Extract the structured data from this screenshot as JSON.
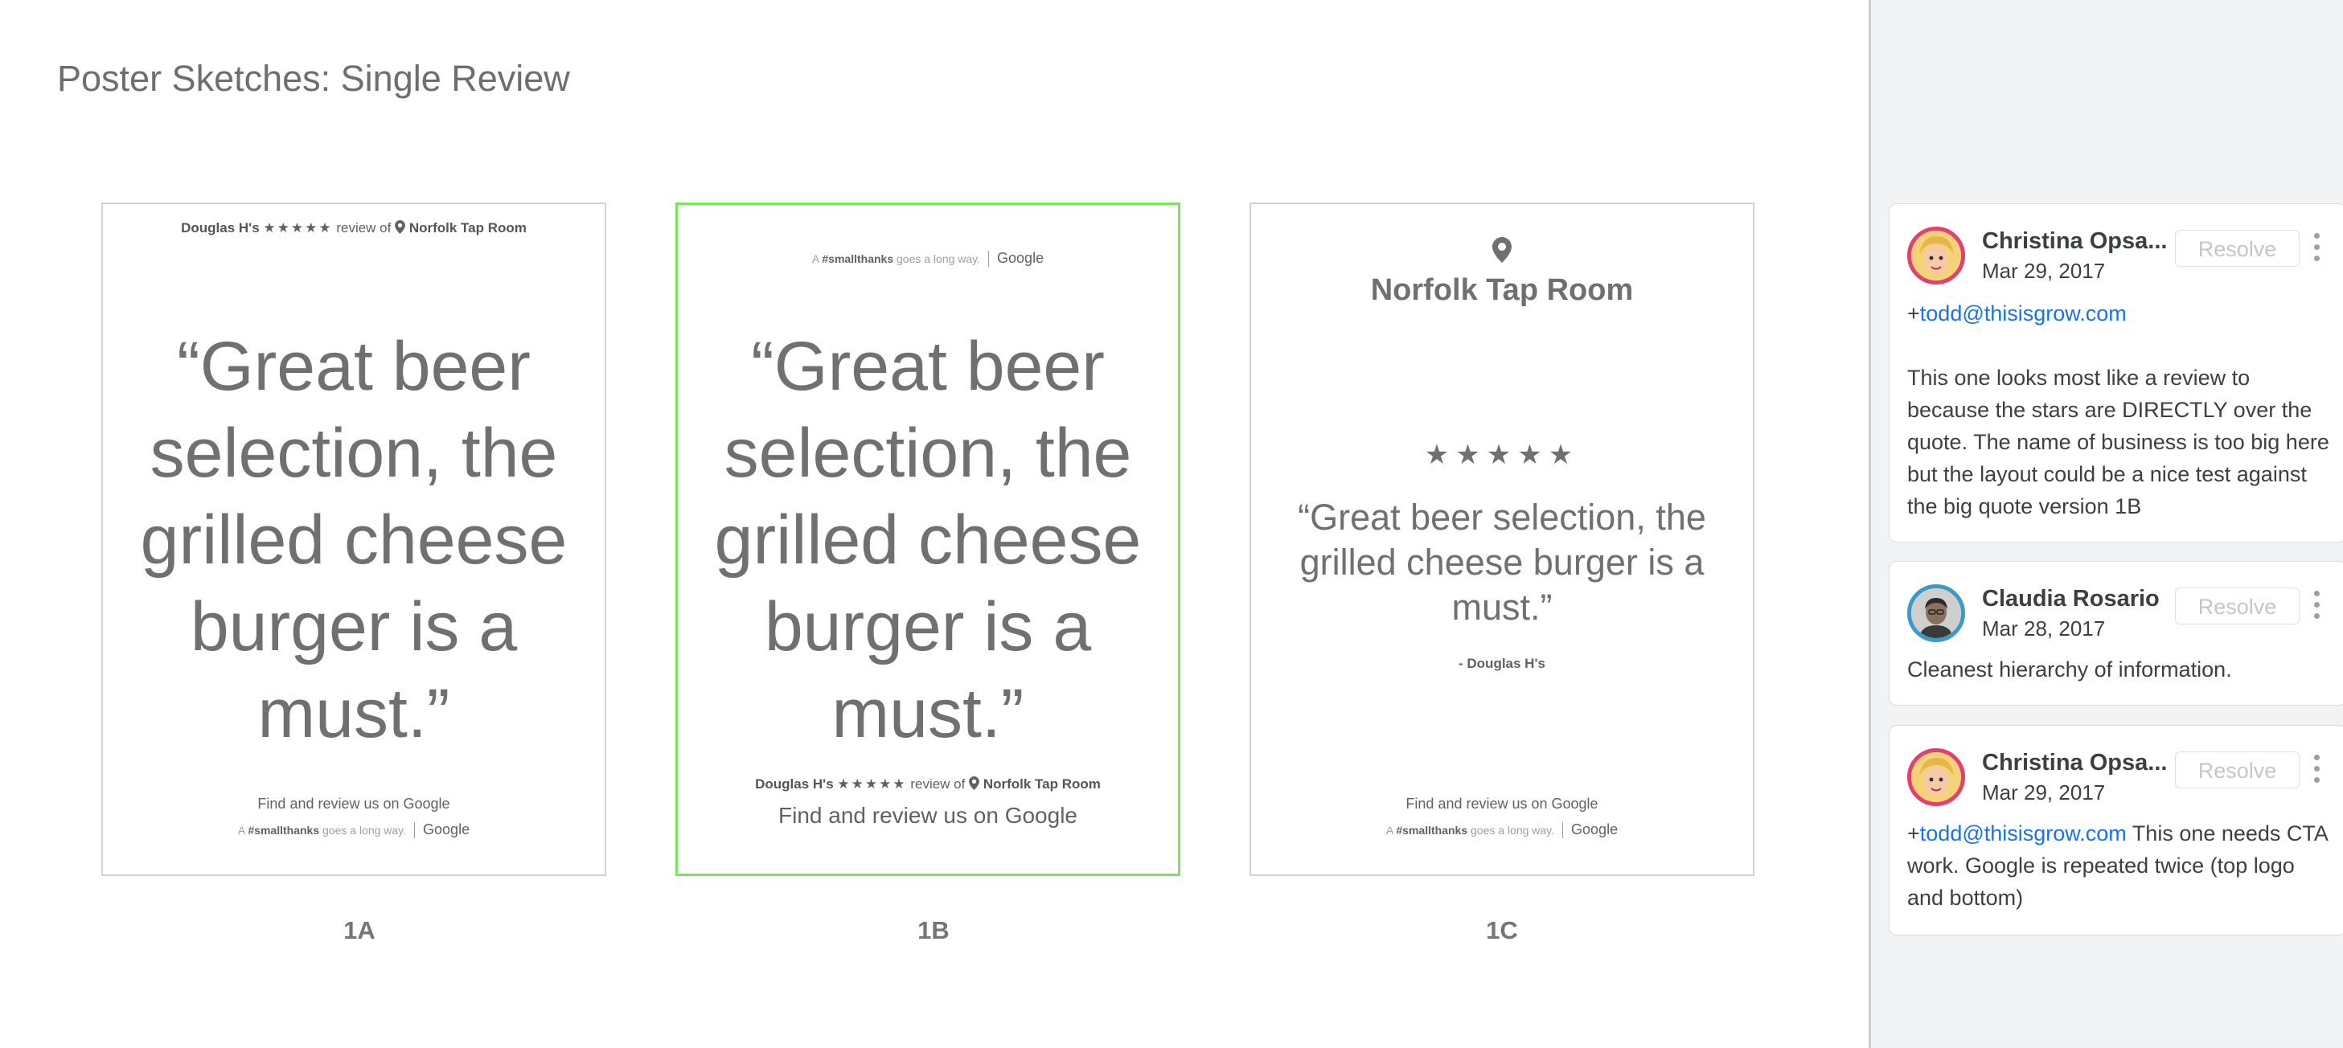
{
  "page": {
    "title": "Poster Sketches: Single Review"
  },
  "posters": [
    {
      "label": "1A",
      "byline": {
        "reviewer": "Douglas H's",
        "stars": "★★★★★",
        "review_of": "review of",
        "business": "Norfolk Tap Room"
      },
      "quote": "“Great beer selection, the grilled cheese burger is a must.”",
      "find_text": "Find and review us on Google",
      "tagline": {
        "prefix": "A",
        "hashtag": "#smallthanks",
        "suffix": "goes a long way.",
        "logo": "Google"
      }
    },
    {
      "label": "1B",
      "tagline": {
        "prefix": "A",
        "hashtag": "#smallthanks",
        "suffix": "goes a long way.",
        "logo": "Google"
      },
      "quote": "“Great beer selection, the grilled cheese burger is a must.”",
      "byline": {
        "reviewer": "Douglas H's",
        "stars": "★★★★★",
        "review_of": "review of",
        "business": "Norfolk Tap Room"
      },
      "find_text": "Find and review us on Google"
    },
    {
      "label": "1C",
      "business": "Norfolk Tap Room",
      "stars": "★★★★★",
      "quote": "“Great beer selection, the grilled cheese burger is a must.”",
      "author": "- Douglas H's",
      "find_text": "Find and review us on Google",
      "tagline": {
        "prefix": "A",
        "hashtag": "#smallthanks",
        "suffix": "goes a long way.",
        "logo": "Google"
      }
    }
  ],
  "comments": [
    {
      "author": "Christina Opsa...",
      "date": "Mar 29, 2017",
      "resolve_label": "Resolve",
      "mention_prefix": "+",
      "mention": "todd@thisisgrow.com",
      "text": "This one looks most like a review to because the stars are DIRECTLY over the quote. The name of business is too big here but the layout could be a nice test against the big quote version 1B"
    },
    {
      "author": "Claudia Rosario",
      "date": "Mar 28, 2017",
      "resolve_label": "Resolve",
      "text": "Cleanest hierarchy of information."
    },
    {
      "author": "Christina Opsa...",
      "date": "Mar 29, 2017",
      "resolve_label": "Resolve",
      "mention_prefix": "+",
      "mention": "todd@thisisgrow.com",
      "text": " This one needs CTA work. Google is repeated twice (top logo and bottom)"
    }
  ],
  "colors": {
    "selected_border": "#76e65e",
    "link": "#1a73e8",
    "avatar_ring_pink": "#e4406f",
    "avatar_ring_blue": "#3c9bc6"
  },
  "icons": [
    "location-pin-icon",
    "star-icon",
    "more-vert-icon",
    "avatar-cartoon",
    "avatar-photo"
  ]
}
